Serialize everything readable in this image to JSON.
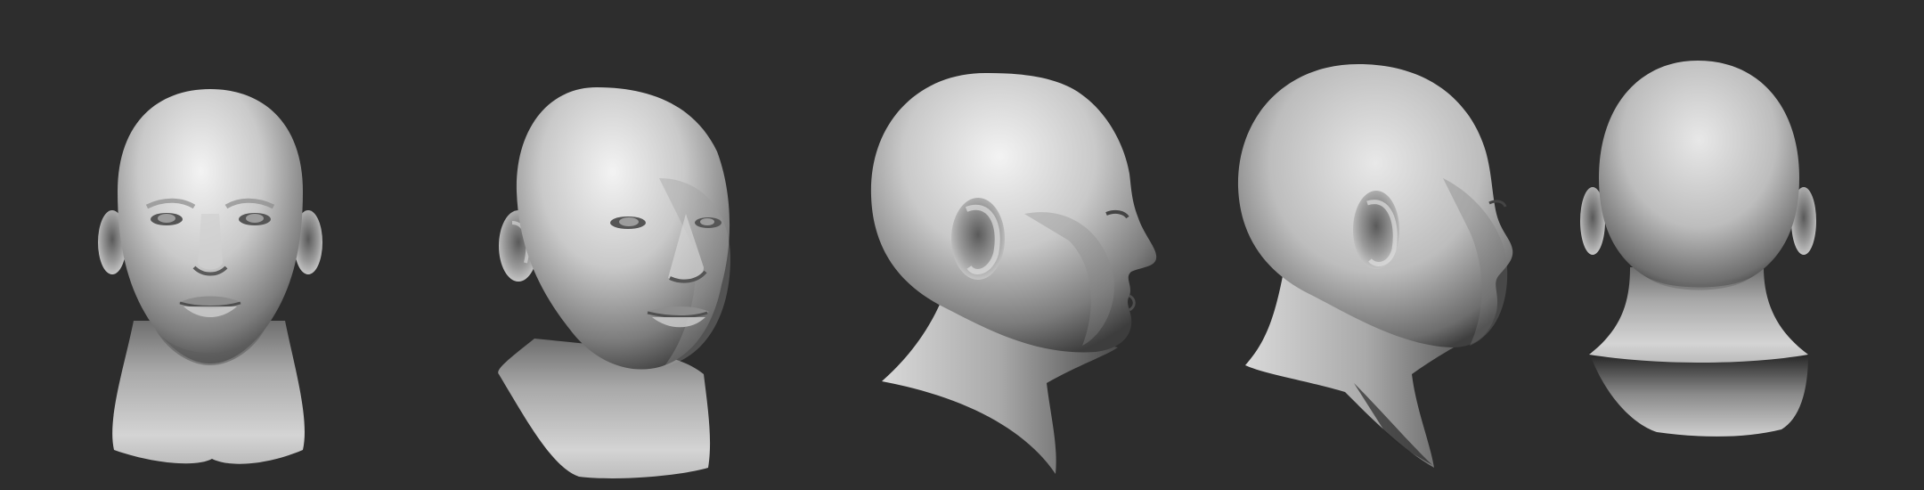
{
  "scene": {
    "background": "#2d2d2d",
    "material": {
      "highlight": "#f2f2f2",
      "mid": "#b8b8b8",
      "shadow": "#5a5a5a",
      "deep": "#1e1e1e"
    },
    "views": [
      {
        "id": "front",
        "name": "head-view-front"
      },
      {
        "id": "three-quarter",
        "name": "head-view-three-quarter"
      },
      {
        "id": "profile-right",
        "name": "head-view-profile"
      },
      {
        "id": "back-three-quarter",
        "name": "head-view-back-three-quarter"
      },
      {
        "id": "back",
        "name": "head-view-back"
      }
    ]
  }
}
